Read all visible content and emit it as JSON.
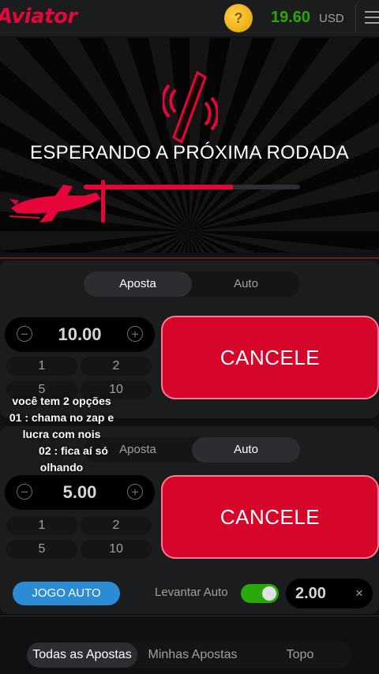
{
  "header": {
    "logo": "Aviator",
    "coin_symbol": "?",
    "balance": "19.60",
    "currency": "USD"
  },
  "game": {
    "status_text": "ESPERANDO A PRÓXIMA RODADA",
    "progress_fraction": 0.69
  },
  "bet_panels": [
    {
      "tabs": [
        "Aposta",
        "Auto"
      ],
      "active_tab": "Aposta",
      "amount": "10.00",
      "quick_amounts": [
        "1",
        "2",
        "5",
        "10"
      ],
      "action_label": "CANCELE"
    },
    {
      "tabs": [
        "Aposta",
        "Auto"
      ],
      "active_tab": "Auto",
      "amount": "5.00",
      "quick_amounts": [
        "1",
        "2",
        "5",
        "10"
      ],
      "action_label": "CANCELE"
    }
  ],
  "overlay_caption": {
    "line1": "você tem 2 opções",
    "line2": "01 : chama no zap e",
    "line3": "lucra com nois",
    "line4": "02 : fica aí só",
    "line5": "olhando"
  },
  "auto_controls": {
    "auto_play_label": "JOGO AUTO",
    "cashout_label": "Levantar Auto",
    "cashout_enabled": true,
    "cashout_value": "2.00",
    "clear_symbol": "×"
  },
  "bottom_tabs": [
    "Todas as Apostas",
    "Minhas Apostas",
    "Topo"
  ],
  "colors": {
    "brand_red": "#e50539",
    "balance_green": "#28a909",
    "auto_blue": "#2b8bd4"
  }
}
